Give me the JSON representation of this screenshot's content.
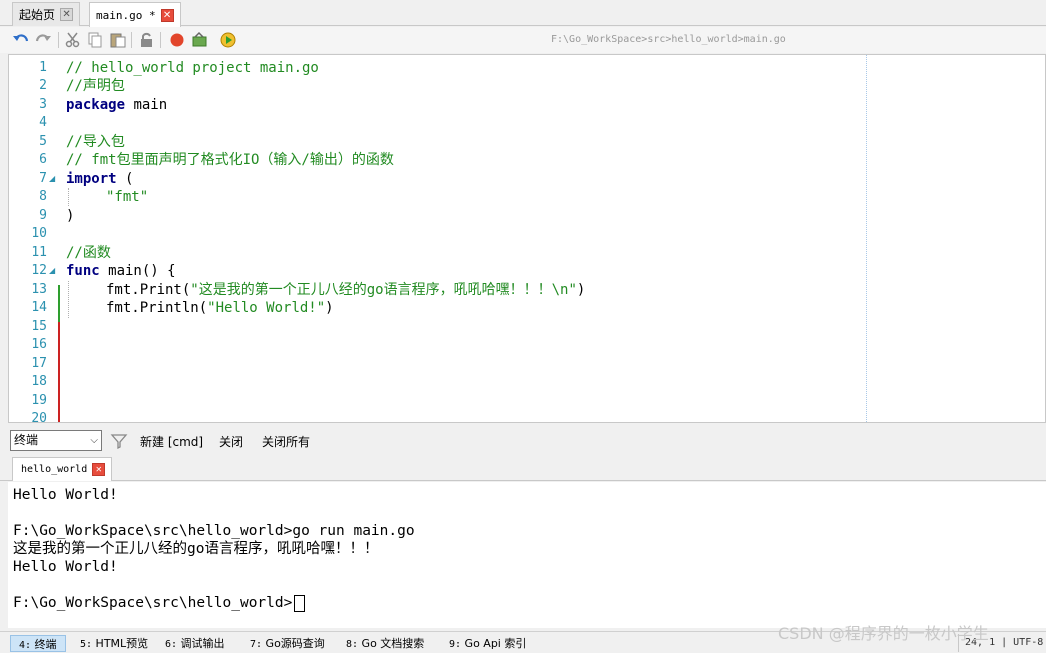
{
  "tabs": [
    {
      "label": "起始页"
    },
    {
      "label": "main.go *"
    }
  ],
  "toolbar": {
    "filepath": "F:\\Go_WorkSpace>src>hello_world>main.go"
  },
  "editor": {
    "line_numbers": [
      "1",
      "2",
      "3",
      "4",
      "5",
      "6",
      "7",
      "8",
      "9",
      "10",
      "11",
      "12",
      "13",
      "14",
      "15",
      "16",
      "17",
      "18",
      "19",
      "20"
    ],
    "lines": [
      {
        "n": "1",
        "text": "// hello_world project main.go"
      },
      {
        "n": "2",
        "text": "//声明包"
      },
      {
        "n": "3",
        "kw": "package",
        "rest": " main"
      },
      {
        "n": "5",
        "text": "//导入包"
      },
      {
        "n": "6",
        "text": "// fmt包里面声明了格式化IO（输入/输出）的函数"
      },
      {
        "n": "7",
        "kw": "import",
        "rest": " ("
      },
      {
        "n": "8",
        "str": "\"fmt\""
      },
      {
        "n": "9",
        "rest": ")"
      },
      {
        "n": "11",
        "text": "//函数"
      },
      {
        "n": "12",
        "kw": "func",
        "rest": " main() {"
      },
      {
        "n": "13",
        "pre": "fmt.Print(",
        "str": "\"这是我的第一个正儿八经的go语言程序，吼吼哈嘿！！！\\n\"",
        "post": ")"
      },
      {
        "n": "14",
        "pre": "fmt.Println(",
        "str": "\"Hello World!\"",
        "post": ")"
      }
    ]
  },
  "output_bar": {
    "select_value": "终端",
    "new_cmd": "新建 [cmd]",
    "close": "关闭",
    "close_all": "关闭所有",
    "tab_label": "hello_world"
  },
  "terminal": {
    "lines": [
      "Hello World!",
      "",
      "F:\\Go_WorkSpace\\src\\hello_world>go run main.go",
      "这是我的第一个正儿八经的go语言程序，吼吼哈嘿！！！",
      "Hello World!",
      "",
      "F:\\Go_WorkSpace\\src\\hello_world>"
    ]
  },
  "statusbar": {
    "tabs": [
      {
        "num": "4:",
        "label": "终端"
      },
      {
        "num": "5:",
        "label": "HTML预览"
      },
      {
        "num": "6:",
        "label": "调试输出"
      },
      {
        "num": "7:",
        "label": "Go源码查询"
      },
      {
        "num": "8:",
        "label": "Go 文档搜索"
      },
      {
        "num": "9:",
        "label": "Go Api 索引"
      }
    ],
    "cursor_position": "24,  1  | UTF-8",
    "watermark": "CSDN @程序界的一枚小学生"
  },
  "colors": {
    "comment": "#228b22",
    "keyword": "#000080",
    "line_number": "#2b91af",
    "change_bar": "#cc2222",
    "active_status_tab": "#cde4f7"
  }
}
